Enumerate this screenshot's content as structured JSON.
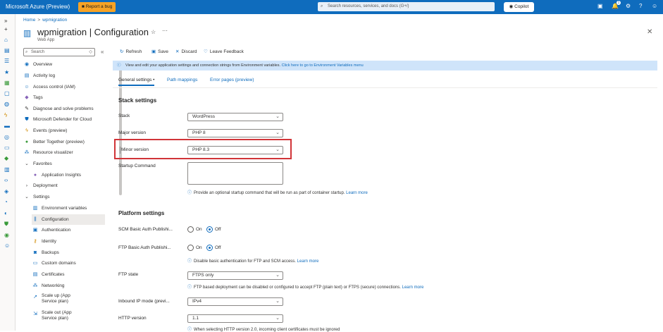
{
  "topbar": {
    "brand": "Microsoft Azure (Preview)",
    "report_bug": "Report a bug",
    "search_placeholder": "Search resources, services, and docs (G+/)",
    "copilot": "Copilot",
    "notification_count": "1"
  },
  "breadcrumb": {
    "home": "Home",
    "item": "wpmigration"
  },
  "header": {
    "title": "wpmigration | Configuration",
    "subtitle": "Web App"
  },
  "sidebar": {
    "search_placeholder": "Search",
    "items": [
      {
        "label": "Overview"
      },
      {
        "label": "Activity log"
      },
      {
        "label": "Access control (IAM)"
      },
      {
        "label": "Tags"
      },
      {
        "label": "Diagnose and solve problems"
      },
      {
        "label": "Microsoft Defender for Cloud"
      },
      {
        "label": "Events (preview)"
      },
      {
        "label": "Better Together (preview)"
      },
      {
        "label": "Resource visualizer"
      },
      {
        "label": "Favorites"
      },
      {
        "label": "Application Insights"
      },
      {
        "label": "Deployment"
      },
      {
        "label": "Settings"
      },
      {
        "label": "Environment variables"
      },
      {
        "label": "Configuration"
      },
      {
        "label": "Authentication"
      },
      {
        "label": "Identity"
      },
      {
        "label": "Backups"
      },
      {
        "label": "Custom domains"
      },
      {
        "label": "Certificates"
      },
      {
        "label": "Networking"
      },
      {
        "label": "Scale up (App Service plan)"
      },
      {
        "label": "Scale out (App Service plan)"
      }
    ]
  },
  "toolbar": {
    "refresh": "Refresh",
    "save": "Save",
    "discard": "Discard",
    "feedback": "Leave Feedback"
  },
  "infobar": {
    "text": "View and edit your application settings and connection strings from Environment variables.",
    "link": "Click here to go to Environment Variables menu"
  },
  "tabs": [
    "General settings",
    "Path mappings",
    "Error pages (preview)"
  ],
  "stack_settings": {
    "heading": "Stack settings",
    "stack_label": "Stack",
    "stack_value": "WordPress",
    "major_label": "Major version",
    "major_value": "PHP 8",
    "minor_label": "Minor version",
    "minor_value": "PHP 8.3",
    "startup_label": "Startup Command",
    "startup_hint": "Provide an optional startup command that will be run as part of container startup.",
    "learn_more": "Learn more"
  },
  "platform_settings": {
    "heading": "Platform settings",
    "scm_label": "SCM Basic Auth Publishi...",
    "ftp_basic_label": "FTP Basic Auth Publishi...",
    "on": "On",
    "off": "Off",
    "ftp_basic_hint": "Disable basic authentication for FTP and SCM access.",
    "ftp_state_label": "FTP state",
    "ftp_state_value": "FTPS only",
    "ftp_state_hint": "FTP based deployment can be disabled or configured to accept FTP (plain text) or FTPS (secure) connections.",
    "inbound_label": "Inbound IP mode (previ...",
    "inbound_value": "IPv4",
    "http_label": "HTTP version",
    "http_value": "1.1",
    "http_hint": "When selecting HTTP version 2.0, incoming client certificates must be ignored",
    "learn_more": "Learn more"
  }
}
